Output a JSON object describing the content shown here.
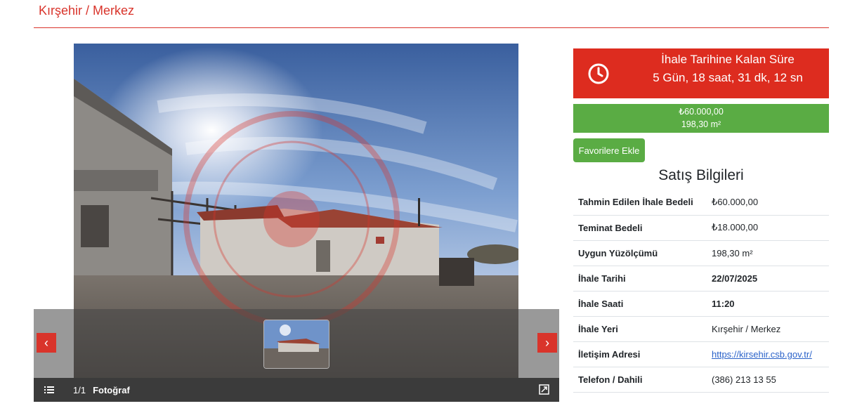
{
  "header": {
    "title": "Kırşehir / Merkez"
  },
  "gallery": {
    "counter": "1/1",
    "label": "Fotoğraf",
    "prev_symbol": "‹",
    "next_symbol": "›",
    "icons": {
      "menu": "list-icon",
      "expand": "expand-icon",
      "clock": "clock-icon"
    }
  },
  "countdown": {
    "title": "İhale Tarihine Kalan Süre",
    "value": "5 Gün, 18 saat, 31 dk, 12 sn"
  },
  "price": {
    "amount": "₺60.000,00",
    "area": "198,30 m²"
  },
  "favorites_label": "Favorilere Ekle",
  "sales_info": {
    "title": "Satış Bilgileri",
    "rows": [
      {
        "label": "Tahmin Edilen İhale Bedeli",
        "value": "₺60.000,00"
      },
      {
        "label": "Teminat Bedeli",
        "value": "₺18.000,00"
      },
      {
        "label": "Uygun Yüzölçümü",
        "value": "198,30 m²"
      },
      {
        "label": "İhale Tarihi",
        "value": "22/07/2025"
      },
      {
        "label": "İhale Saati",
        "value": "11:20"
      },
      {
        "label": "İhale Yeri",
        "value": "Kırşehir / Merkez"
      },
      {
        "label": "İletişim Adresi",
        "value": "https://kirsehir.csb.gov.tr/"
      },
      {
        "label": "Telefon / Dahili",
        "value": "(386) 213 13 55"
      }
    ]
  },
  "colors": {
    "accent_red": "#dd2c1f",
    "accent_green": "#5aac44",
    "link_blue": "#2a62c9"
  }
}
